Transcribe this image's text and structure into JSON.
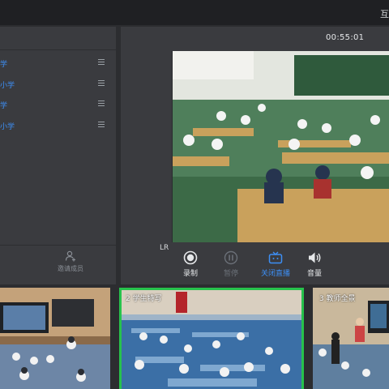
{
  "app": {
    "title": "互"
  },
  "sidebar": {
    "items": [
      {
        "label": "学"
      },
      {
        "label": "小学"
      },
      {
        "label": "学"
      },
      {
        "label": "小学"
      }
    ],
    "invite_label": "邀请成员"
  },
  "main": {
    "timer": "00:55:01",
    "audio_channel": "LR",
    "controls": [
      {
        "label": "录制",
        "icon": "record-icon",
        "color": "#e6e8ea"
      },
      {
        "label": "暂停",
        "icon": "pause-icon",
        "color": "#6b7078"
      },
      {
        "label": "关闭直播",
        "icon": "tv-live-icon",
        "color": "#3d8ff5"
      },
      {
        "label": "音量",
        "icon": "speaker-icon",
        "color": "#e6e8ea"
      }
    ]
  },
  "thumbnails": [
    {
      "label": ""
    },
    {
      "label": "2 学生特写",
      "active": true
    },
    {
      "label": "3 教师全景"
    }
  ],
  "colors": {
    "accent": "#3d8ff5",
    "active_border": "#27c24c",
    "panel": "#3a3b3f"
  }
}
